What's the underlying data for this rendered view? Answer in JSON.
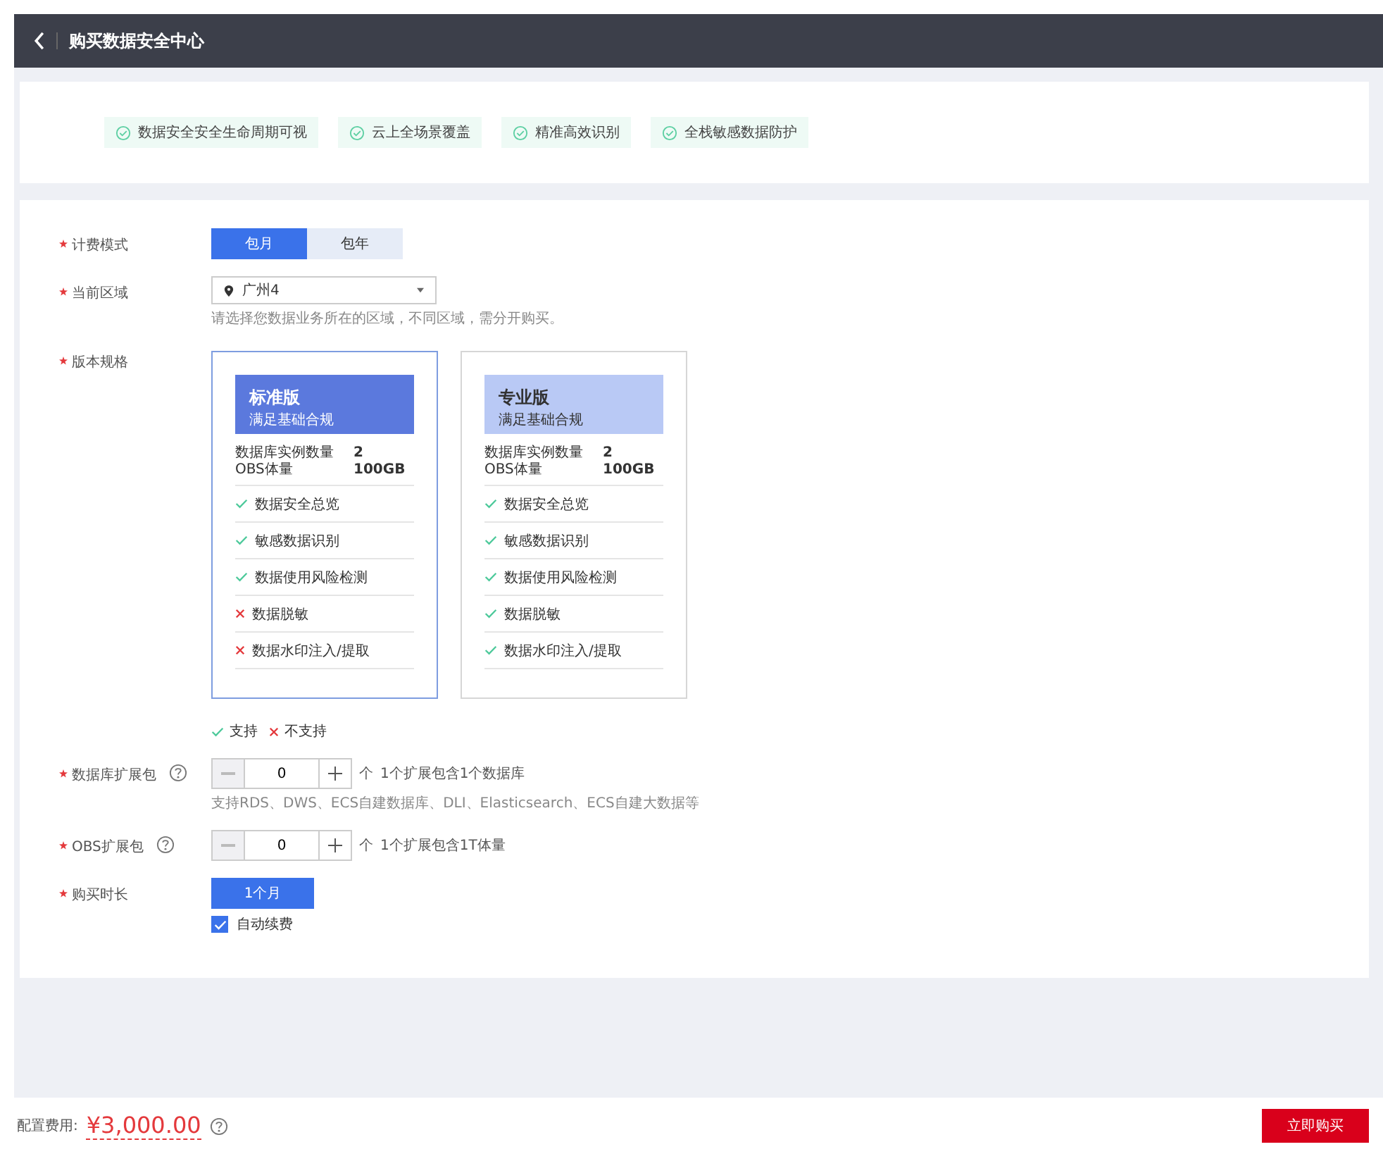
{
  "header": {
    "title": "购买数据安全中心"
  },
  "highlights": [
    "数据安全安全生命周期可视",
    "云上全场景覆盖",
    "精准高效识别",
    "全栈敏感数据防护"
  ],
  "form": {
    "billing": {
      "label": "计费模式",
      "required": true,
      "options": [
        {
          "label": "包月",
          "selected": true
        },
        {
          "label": "包年",
          "selected": false
        }
      ]
    },
    "region": {
      "label": "当前区域",
      "required": true,
      "value": "广州4",
      "hint": "请选择您数据业务所在的区域，不同区域，需分开购买。"
    },
    "edition": {
      "label": "版本规格",
      "required": true,
      "cards": [
        {
          "name": "标准版",
          "subtitle": "满足基础合规",
          "selected": true,
          "specs": [
            {
              "label": "数据库实例数量",
              "value": "2"
            },
            {
              "label": "OBS体量",
              "value": "100GB"
            }
          ],
          "features": [
            {
              "label": "数据安全总览",
              "supported": true
            },
            {
              "label": "敏感数据识别",
              "supported": true
            },
            {
              "label": "数据使用风险检测",
              "supported": true
            },
            {
              "label": "数据脱敏",
              "supported": false
            },
            {
              "label": "数据水印注入/提取",
              "supported": false
            }
          ]
        },
        {
          "name": "专业版",
          "subtitle": "满足基础合规",
          "selected": false,
          "specs": [
            {
              "label": "数据库实例数量",
              "value": "2"
            },
            {
              "label": "OBS体量",
              "value": "100GB"
            }
          ],
          "features": [
            {
              "label": "数据安全总览",
              "supported": true
            },
            {
              "label": "敏感数据识别",
              "supported": true
            },
            {
              "label": "数据使用风险检测",
              "supported": true
            },
            {
              "label": "数据脱敏",
              "supported": true
            },
            {
              "label": "数据水印注入/提取",
              "supported": true
            }
          ]
        }
      ],
      "legend": [
        {
          "label": "支持",
          "supported": true
        },
        {
          "label": "不支持",
          "supported": false
        }
      ]
    },
    "db_pack": {
      "label": "数据库扩展包",
      "required": true,
      "value": "0",
      "unit": "个",
      "note": "1个扩展包含1个数据库",
      "hint": "支持RDS、DWS、ECS自建数据库、DLI、Elasticsearch、ECS自建大数据等"
    },
    "obs_pack": {
      "label": "OBS扩展包",
      "required": true,
      "value": "0",
      "unit": "个",
      "note": "1个扩展包含1T体量"
    },
    "duration": {
      "label": "购买时长",
      "required": true,
      "options": [
        {
          "label": "1个月",
          "selected": true
        }
      ],
      "auto_renew": {
        "label": "自动续费",
        "checked": true
      }
    }
  },
  "footer": {
    "cost_label": "配置费用:",
    "price": "¥3,000.00",
    "buy_button": "立即购买"
  }
}
